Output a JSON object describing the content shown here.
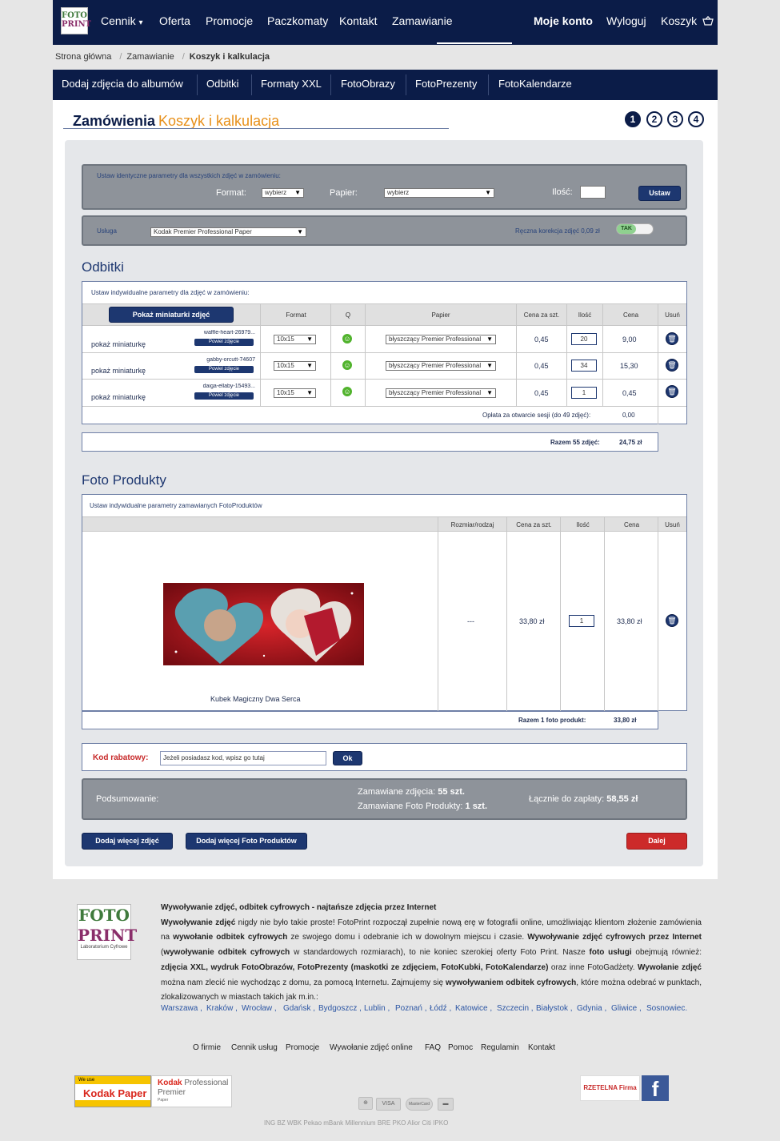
{
  "nav": {
    "logo_line1": "FOTO",
    "logo_line2": "PRINT",
    "items": [
      "Cennik",
      "Oferta",
      "Promocje",
      "Paczkomaty",
      "Kontakt",
      "Zamawianie"
    ],
    "dropdown_caret": "▾",
    "my_account": "Moje konto",
    "logout": "Wyloguj",
    "cart": "Koszyk",
    "cart_icon": "basket-icon"
  },
  "breadcrumb": [
    "Strona główna",
    "Zamawianie",
    "Koszyk i kalkulacja"
  ],
  "subnav": [
    "Dodaj zdjęcia do albumów",
    "Odbitki",
    "Formaty XXL",
    "FotoObrazy",
    "FotoPrezenty",
    "FotoKalendarze"
  ],
  "page": {
    "title": "Zamówienia",
    "subtitle": "Koszyk i kalkulacja",
    "steps": [
      "1",
      "2",
      "3",
      "4"
    ]
  },
  "global_params": {
    "heading": "Ustaw identyczne parametry dla wszystkich zdjęć w zamówieniu:",
    "format_label": "Format:",
    "format_value": "wybierz",
    "paper_label": "Papier:",
    "paper_value": "wybierz",
    "qty_label": "Ilość:",
    "qty_value": "",
    "set_button": "Ustaw"
  },
  "service": {
    "label": "Usługa",
    "value": "Kodak Premier Professional Paper",
    "manual_correction": "Ręczna korekcja zdjęć 0,09 zł",
    "toggle_label": "TAK"
  },
  "prints": {
    "heading": "Odbitki",
    "box_heading": "Ustaw indywidualne parametry dla zdjęć w zamówieniu:",
    "show_thumbs_button": "Pokaż miniaturki zdjęć",
    "columns": [
      "Format",
      "Q",
      "Papier",
      "Cena za szt.",
      "Ilość",
      "Cena",
      "Usuń"
    ],
    "rows": [
      {
        "show": "pokaż miniaturkę",
        "file": "waffle-heart-26979...",
        "enlarge": "Powiel zdjęcie",
        "format": "10x15",
        "paper": "błyszczący Premier Professional",
        "unit": "0,45",
        "qty": "20",
        "price": "9,00"
      },
      {
        "show": "pokaż miniaturkę",
        "file": "gabby-orcutt-74607",
        "enlarge": "Powiel zdjęcie",
        "format": "10x15",
        "paper": "błyszczący Premier Professional",
        "unit": "0,45",
        "qty": "34",
        "price": "15,30"
      },
      {
        "show": "pokaż miniaturkę",
        "file": "daiga-ellaby-15493...",
        "enlarge": "Powiel zdjęcie",
        "format": "10x15",
        "paper": "błyszczący Premier Professional",
        "unit": "0,45",
        "qty": "1",
        "price": "0,45"
      }
    ],
    "session_fee_label": "Opłata za otwarcie sesji (do 49 zdjęć):",
    "session_fee_value": "0,00",
    "total_label": "Razem 55 zdjęć:",
    "total_value": "24,75 zł"
  },
  "products": {
    "heading": "Foto Produkty",
    "box_heading": "Ustaw indywidualne parametry zamawianych FotoProduktów",
    "columns": [
      "Rozmiar/rodzaj",
      "Cena za szt.",
      "Ilość",
      "Cena",
      "Usuń"
    ],
    "item": {
      "name": "Kubek Magiczny Dwa Serca",
      "size": "---",
      "unit": "33,80 zł",
      "qty": "1",
      "price": "33,80 zł"
    },
    "total_label": "Razem 1 foto produkt:",
    "total_value": "33,80 zł"
  },
  "discount": {
    "label": "Kod rabatowy:",
    "placeholder": "Jeżeli posiadasz kod, wpisz go tutaj",
    "button": "Ok"
  },
  "summary": {
    "label": "Podsumowanie:",
    "photos_label": "Zamawiane zdjęcia:",
    "photos_value": "55 szt.",
    "products_label": "Zamawiane Foto Produkty:",
    "products_value": "1 szt.",
    "total_label": "Łącznie do zapłaty:",
    "total_value": "58,55 zł"
  },
  "actions": {
    "add_photos": "Dodaj więcej zdjęć",
    "add_products": "Dodaj więcej Foto Produktów",
    "next": "Dalej"
  },
  "footer": {
    "logo_line1": "FOTO",
    "logo_line2": "PRINT",
    "logo_tagline": "Laboratorium Cyfrowe",
    "heading": "Wywoływanie zdjęć, odbitek cyfrowych - najtańsze zdjęcia przez Internet",
    "body_html_parts": [
      [
        "b",
        "Wywoływanie zdjęć"
      ],
      [
        "t",
        " nigdy nie było takie proste! FotoPrint rozpoczął zupełnie nową erę w fotografii online, umożliwiając klientom złożenie zamówienia na "
      ],
      [
        "b",
        "wywołanie odbitek cyfrowych"
      ],
      [
        "t",
        " ze swojego domu i odebranie ich w dowolnym miejscu i czasie. "
      ],
      [
        "b",
        "Wywoływanie zdjęć cyfrowych przez Internet"
      ],
      [
        "t",
        " ("
      ],
      [
        "b",
        "wywoływanie odbitek cyfrowych"
      ],
      [
        "t",
        " w standardowych rozmiarach), to nie koniec szerokiej oferty Foto Print. Nasze "
      ],
      [
        "b",
        "foto usługi"
      ],
      [
        "t",
        " obejmują również: "
      ],
      [
        "b",
        "zdjęcia XXL, wydruk FotoObrazów, FotoPrezenty (maskotki ze zdjęciem, FotoKubki, FotoKalendarze)"
      ],
      [
        "t",
        " oraz inne FotoGadżety. "
      ],
      [
        "b",
        "Wywołanie zdjęć"
      ],
      [
        "t",
        " można nam zlecić nie wychodząc z domu, za pomocą Internetu. Zajmujemy się "
      ],
      [
        "b",
        "wywoływaniem odbitek cyfrowych"
      ],
      [
        "t",
        ", które można odebrać w punktach, zlokalizowanych w miastach takich jak m.in.:"
      ]
    ],
    "cities": [
      "Warszawa",
      "Kraków",
      "Wrocław",
      "Gdańsk",
      "Bydgoszcz",
      "Lublin",
      "Poznań",
      "Łódź",
      "Katowice",
      "Szczecin",
      "Białystok",
      "Gdynia",
      "Gliwice",
      "Sosnowiec"
    ],
    "links": [
      "O firmie",
      "Cennik usług",
      "Promocje",
      "Wywołanie zdjęć online",
      "FAQ",
      "Pomoc",
      "Regulamin",
      "Kontakt"
    ],
    "kodak_we_use": "We use",
    "kodak_paper": "Kodak Paper",
    "kodak_pro": "Kodak",
    "kodak_pro2": "Professional",
    "kodak_premier": "Premier",
    "kodak_paper_small": "Paper",
    "payments": [
      "VISA",
      "MasterCard"
    ],
    "banks": "ING  BZ WBK  Pekao  mBank  Millennium  BRE  PKO  Alior  Citi  IPKO",
    "rzetelna": "RZETELNA Firma",
    "facebook": "f"
  }
}
